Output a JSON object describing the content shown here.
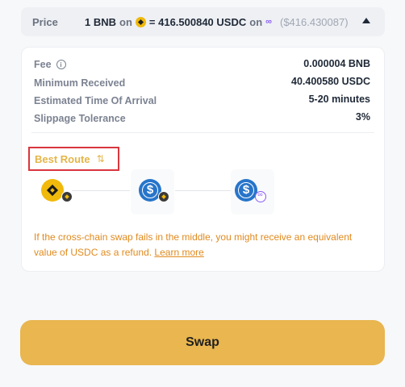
{
  "price": {
    "label": "Price",
    "from_amount": "1 BNB",
    "on1": "on",
    "equals": "= 416.500840 USDC",
    "on2": "on",
    "usd_approx": "($416.430087)"
  },
  "details": {
    "fee_label": "Fee",
    "fee_value": "0.000004 BNB",
    "min_received_label": "Minimum Received",
    "min_received_value": "40.400580 USDC",
    "eta_label": "Estimated Time Of Arrival",
    "eta_value": "5-20 minutes",
    "slippage_label": "Slippage Tolerance",
    "slippage_value": "3%"
  },
  "route": {
    "label": "Best Route",
    "steps": [
      {
        "token": "BNB",
        "chain": "BNB Chain",
        "token_icon": "bnb-icon",
        "chain_icon": "bnb-chain-icon"
      },
      {
        "token": "USDC",
        "chain": "BNB Chain",
        "token_icon": "usdc-icon",
        "chain_icon": "bnb-chain-icon"
      },
      {
        "token": "USDC",
        "chain": "Chainlink",
        "token_icon": "usdc-icon",
        "chain_icon": "link-chain-icon"
      }
    ]
  },
  "warning": {
    "text": "If the cross-chain swap fails in the middle, you might receive an equivalent value of USDC as a refund.",
    "link": "Learn more"
  },
  "swap_button": "Swap",
  "colors": {
    "accent": "#e9b64f",
    "route_label": "#e4b547",
    "warning": "#e08a1e",
    "highlight_box": "#d9363e",
    "bnb": "#f0b90b",
    "usdc": "#2775ca",
    "link": "#8b5cf6"
  }
}
